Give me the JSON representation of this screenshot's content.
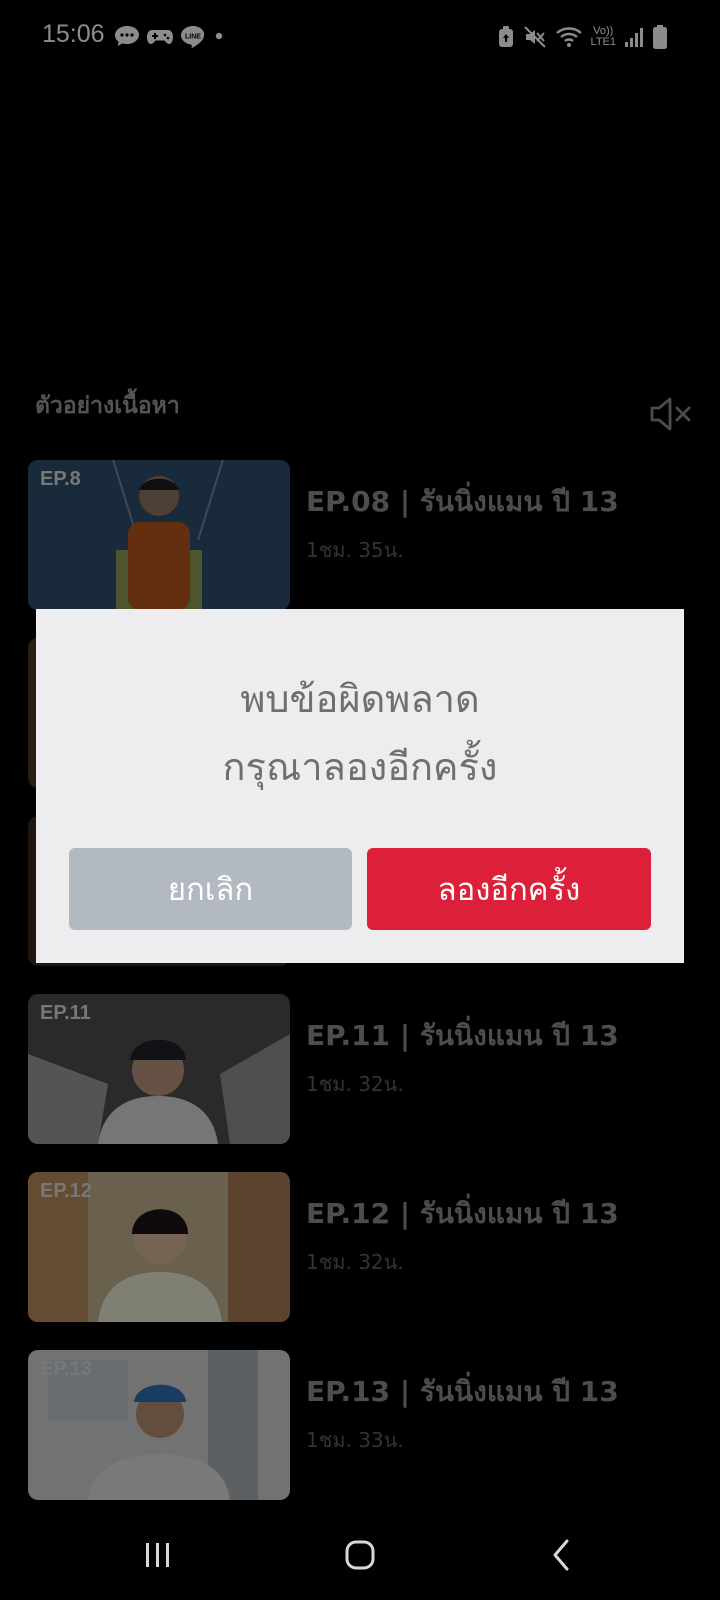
{
  "status_bar": {
    "time": "15:06",
    "lte_top": "Vo))",
    "lte_bottom": "LTE1"
  },
  "section": {
    "title": "ตัวอย่างเนื้อหา"
  },
  "episodes": [
    {
      "badge": "EP.8",
      "title": "EP.08 | รันนิ่งแมน ปี 13",
      "duration": "1ชม. 35น."
    },
    {
      "badge": "EP.11",
      "title": "EP.11 | รันนิ่งแมน ปี 13",
      "duration": "1ชม. 32น."
    },
    {
      "badge": "EP.12",
      "title": "EP.12 | รันนิ่งแมน ปี 13",
      "duration": "1ชม. 32น."
    },
    {
      "badge": "EP.13",
      "title": "EP.13 | รันนิ่งแมน ปี 13",
      "duration": "1ชม. 33น."
    }
  ],
  "dialog": {
    "line1": "พบข้อผิดพลาด",
    "line2": "กรุณาลองอีกครั้ง",
    "cancel_label": "ยกเลิก",
    "retry_label": "ลองอีกครั้ง"
  },
  "colors": {
    "accent": "#dc2039",
    "cancel": "#b3b9c1",
    "dialog_bg": "#ededf0"
  },
  "icons": {
    "mute": "speaker-muted-icon",
    "nav_recents": "recents-icon",
    "nav_home": "home-icon",
    "nav_back": "back-icon"
  }
}
